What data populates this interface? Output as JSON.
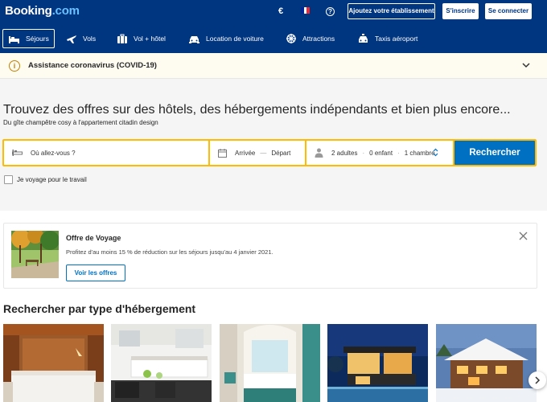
{
  "header": {
    "logo_main": "Booking",
    "logo_suffix": ".com",
    "currency": "€",
    "add_property_label": "Ajoutez votre établissement",
    "signup_label": "S'inscrire",
    "login_label": "Se connecter"
  },
  "nav": {
    "items": [
      {
        "label": "Séjours",
        "icon": "bed-icon"
      },
      {
        "label": "Vols",
        "icon": "plane-icon"
      },
      {
        "label": "Vol + hôtel",
        "icon": "suitcase-icon"
      },
      {
        "label": "Location de voiture",
        "icon": "car-icon"
      },
      {
        "label": "Attractions",
        "icon": "attractions-icon"
      },
      {
        "label": "Taxis aéroport",
        "icon": "taxi-icon"
      }
    ]
  },
  "covid_banner": {
    "text": "Assistance coronavirus (COVID-19)"
  },
  "hero": {
    "title": "Trouvez des offres sur des hôtels, des hébergements indépendants et bien plus encore...",
    "subtitle": "Du gîte champêtre cosy à l'appartement citadin design"
  },
  "search": {
    "destination_placeholder": "Où allez-vous ?",
    "checkin_label": "Arrivée",
    "date_separator": "—",
    "checkout_label": "Départ",
    "guests_adults": "2 adultes",
    "guests_children": "0 enfant",
    "guests_rooms": "1 chambre",
    "guests_separator": "·",
    "submit_label": "Rechercher",
    "work_trip_label": "Je voyage pour le travail"
  },
  "offer": {
    "title": "Offre de Voyage",
    "description": "Profitez d'au moins 15 % de réduction sur les séjours jusqu'au 4 janvier 2021.",
    "button_label": "Voir les offres"
  },
  "property_types": {
    "title": "Rechercher par type d'hébergement"
  },
  "colors": {
    "brand_blue": "#003580",
    "accent_blue": "#0071c2",
    "search_yellow": "#febb02",
    "banner_bg": "#fefbf0",
    "flag_blue": "#002395",
    "flag_white": "#ffffff",
    "flag_red": "#ed2939"
  }
}
